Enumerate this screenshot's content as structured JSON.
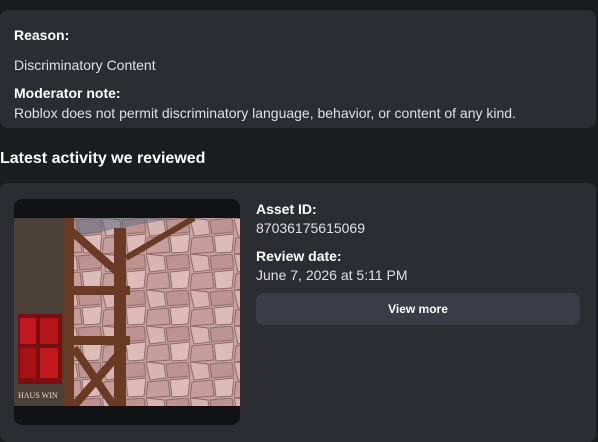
{
  "moderation": {
    "reason_label": "Reason:",
    "reason_value": "Discriminatory Content",
    "note_label": "Moderator note:",
    "note_value": "Roblox does not permit discriminatory language, behavior, or content of any kind."
  },
  "activity": {
    "section_title": "Latest activity we reviewed",
    "asset_id_label": "Asset ID:",
    "asset_id_value": "87036175615069",
    "review_date_label": "Review date:",
    "review_date_value": "June 7, 2026 at 5:11 PM",
    "view_more_label": "View more",
    "thumbnail_caption": "HAUS WIN"
  },
  "colors": {
    "page_background": "#1c1d21",
    "card_background": "#2b2d33",
    "button_background": "#3b3d46"
  }
}
